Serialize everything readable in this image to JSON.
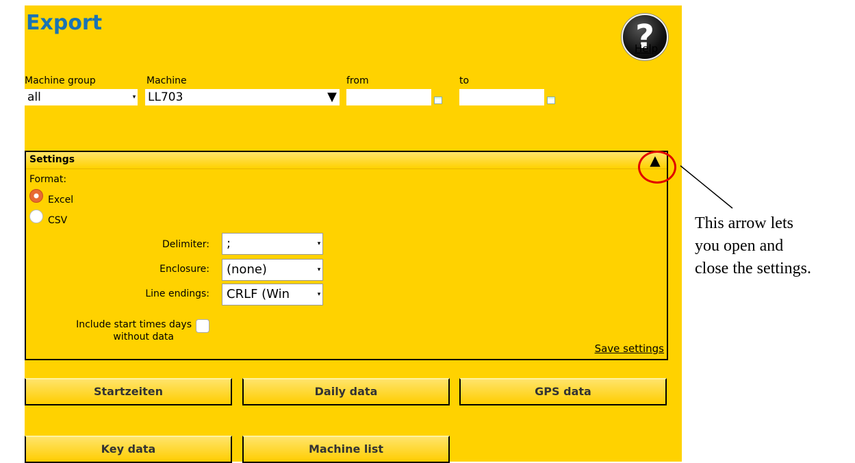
{
  "page": {
    "title": "Export"
  },
  "help": {
    "icon": "question-mark-icon",
    "glyph": "?",
    "label": "Help"
  },
  "filters": {
    "machine_group_label": "Machine group",
    "machine_group_value": "all",
    "machine_label": "Machine",
    "machine_value": "LL703",
    "from_label": "from",
    "to_label": "to"
  },
  "settings": {
    "title": "Settings",
    "toggle_glyph": "▲",
    "format_label": "Format:",
    "format_options": [
      "Excel",
      "CSV"
    ],
    "format_selected": "Excel",
    "delimiter_label": "Delimiter:",
    "delimiter_value": ";",
    "enclosure_label": "Enclosure:",
    "enclosure_value": "(none)",
    "line_endings_label": "Line endings:",
    "line_endings_value": "CRLF (Win",
    "include_label_1": "Include start times days",
    "include_label_2": "without data",
    "save_label": "Save settings"
  },
  "buttons": [
    "Startzeiten",
    "Daily data",
    "GPS data",
    "Key data",
    "Machine list"
  ],
  "annotation": {
    "line1": "This arrow lets",
    "line2": "you open and",
    "line3": "close the settings.",
    "highlight_color": "#e00000"
  }
}
